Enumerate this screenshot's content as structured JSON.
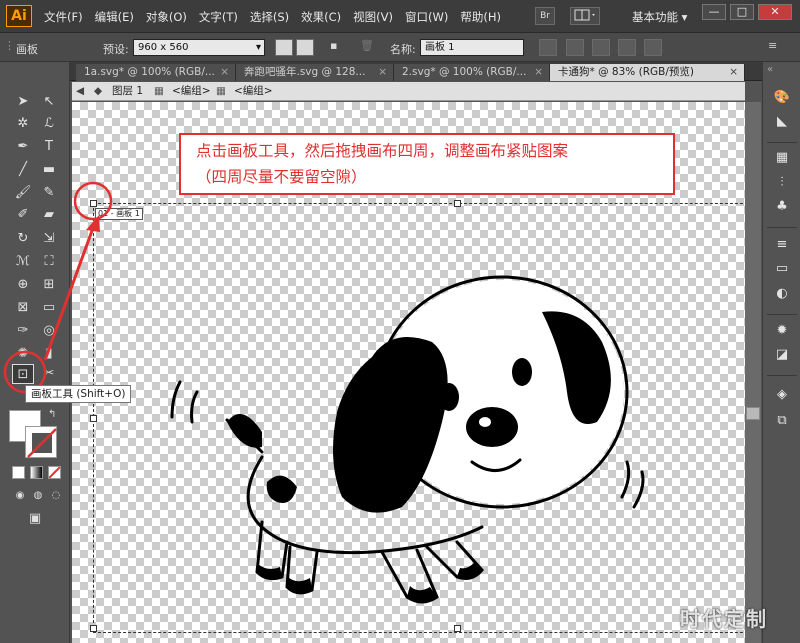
{
  "app": {
    "logo": "Ai"
  },
  "menu": [
    "文件(F)",
    "编辑(E)",
    "对象(O)",
    "文字(T)",
    "选择(S)",
    "效果(C)",
    "视图(V)",
    "窗口(W)",
    "帮助(H)"
  ],
  "bridge_button": "Br",
  "workspace": "基本功能",
  "window_controls": {
    "minimize": "—",
    "restore": "□",
    "close": "✕"
  },
  "control_bar": {
    "panel_name": "画板",
    "preset_label": "预设:",
    "preset_value": "960 x 560",
    "name_label": "名称:",
    "name_value": "画板 1"
  },
  "tabs": [
    {
      "label": "1a.svg* @ 100% (RGB/...",
      "close": "×"
    },
    {
      "label": "奔跑吧骚年.svg @ 128...",
      "close": "×"
    },
    {
      "label": "2.svg* @ 100% (RGB/...",
      "close": "×"
    },
    {
      "label": "卡通狗* @ 83% (RGB/预览)",
      "close": "×"
    }
  ],
  "breadcrumb": {
    "layer": "图层 1",
    "group1": "<编组>",
    "group2": "<编组>"
  },
  "artboard_label": "01 - 画板 1",
  "callout_lines": [
    "点击画板工具，然后拖拽画布四周，调整画布紧贴图案",
    "（四周尽量不要留空隙）"
  ],
  "tooltip": "画板工具 (Shift+O)",
  "watermark": "时代定制",
  "colors": {
    "accent_red": "#e03030",
    "ui_dark": "#535353",
    "menubar": "#3c3c3c"
  }
}
